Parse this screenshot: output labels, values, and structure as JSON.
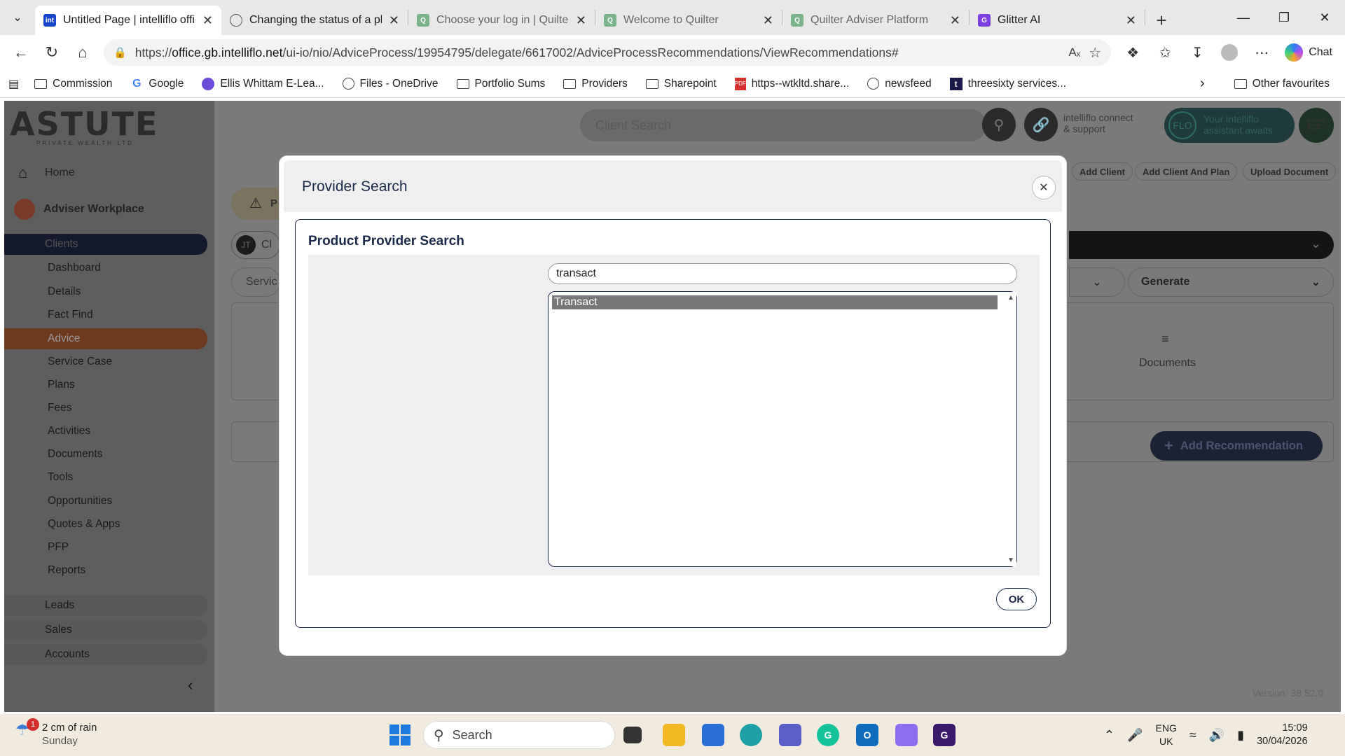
{
  "browser": {
    "tabs": [
      {
        "title": "Untitled Page | intelliflo office",
        "favicon": "int",
        "favcolor": "#1846c8",
        "active": true
      },
      {
        "title": "Changing the status of a plan",
        "favicon": "globe",
        "favcolor": "#555555",
        "active": false
      },
      {
        "title": "Choose your log in | Quilter",
        "favicon": "Q",
        "favcolor": "#7ab38c",
        "active": false
      },
      {
        "title": "Welcome to Quilter",
        "favicon": "Q",
        "favcolor": "#7ab38c",
        "active": false
      },
      {
        "title": "Quilter Adviser Platform",
        "favicon": "Q",
        "favcolor": "#7ab38c",
        "active": false
      },
      {
        "title": "Glitter AI",
        "favicon": "G",
        "favcolor": "#7d3ee0",
        "active": false
      }
    ],
    "url_prefix": "https://",
    "url_host": "office.gb.intelliflo.net",
    "url_path": "/ui-io/nio/AdviceProcess/19954795/delegate/6617002/AdviceProcessRecommendations/ViewRecommendations#",
    "chat_label": "Chat",
    "bookmarks": [
      {
        "label": "Commission",
        "icon": "folder"
      },
      {
        "label": "Google",
        "icon": "google-icon"
      },
      {
        "label": "Ellis Whittam E-Lea...",
        "icon": "ellis-icon"
      },
      {
        "label": "Files - OneDrive",
        "icon": "globe-icon"
      },
      {
        "label": "Portfolio Sums",
        "icon": "folder"
      },
      {
        "label": "Providers",
        "icon": "folder"
      },
      {
        "label": "Sharepoint",
        "icon": "folder"
      },
      {
        "label": "https--wtkltd.share...",
        "icon": "pdf-icon"
      },
      {
        "label": "newsfeed",
        "icon": "globe-icon"
      },
      {
        "label": "threesixty services...",
        "icon": "threesixty-icon"
      }
    ],
    "other_favourites": "Other favourites"
  },
  "app": {
    "logo_main": "ASTUTE",
    "logo_sub": "PRIVATE WEALTH LTD",
    "client_search_placeholder": "Client Search",
    "connect_line1": "intelliflo connect",
    "connect_line2": "& support",
    "flo_badge": "FLO",
    "flo_line1": "Your intelliflo",
    "flo_line2": "assistant awaits",
    "user_initials": "EP",
    "top_buttons": [
      "Add Client",
      "Add Client And Plan",
      "Upload Document"
    ],
    "sidebar": {
      "home": "Home",
      "adviser_workplace": "Adviser Workplace",
      "clients": "Clients",
      "items": [
        "Dashboard",
        "Details",
        "Fact Find",
        "Advice",
        "Service Case",
        "Plans",
        "Fees",
        "Activities",
        "Documents",
        "Tools",
        "Opportunities",
        "Quotes & Apps",
        "PFP",
        "Reports"
      ],
      "groups": [
        "Leads",
        "Sales",
        "Accounts"
      ]
    },
    "client_initials": "JT",
    "client_label_partial": "Cl",
    "service_partial": "Servic",
    "warning_partial": "P",
    "generate_label": "Generate",
    "documents_label": "Documents",
    "add_recommendation": "Add Recommendation",
    "version": "Version: 38.52.0"
  },
  "modal": {
    "title": "Provider Search",
    "section_title": "Product Provider Search",
    "search_value": "transact",
    "results": [
      "Transact"
    ],
    "ok_label": "OK"
  },
  "taskbar": {
    "weather_badge": "1",
    "weather_line1": "2 cm of rain",
    "weather_line2": "Sunday",
    "search_placeholder": "Search",
    "lang_line1": "ENG",
    "lang_line2": "UK",
    "time": "15:09",
    "date": "30/04/2026"
  }
}
